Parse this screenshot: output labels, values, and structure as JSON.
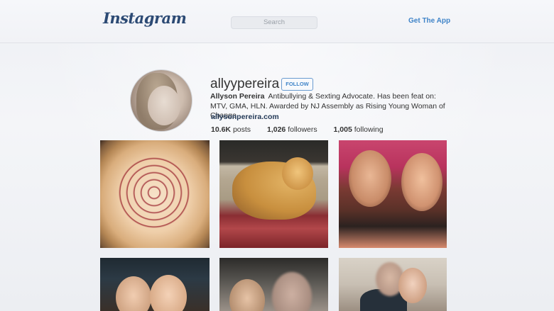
{
  "header": {
    "logo": "Instagram",
    "search_placeholder": "Search",
    "get_app_label": "Get The App"
  },
  "profile": {
    "username": "allyypereira",
    "follow_label": "FOLLOW",
    "full_name": "Allyson Pereira",
    "bio": "Antibullying & Sexting Advocate. Has been feat on: MTV, GMA, HLN. Awarded by NJ Assembly as Rising Young Woman of Change",
    "website": "allysonpereira.com",
    "stats": {
      "posts_count": "10.6K",
      "posts_label": "posts",
      "followers_count": "1,026",
      "followers_label": "followers",
      "following_count": "1,005",
      "following_label": "following"
    }
  },
  "colors": {
    "link_blue": "#3f84c8",
    "logo_navy": "#2c4a74"
  }
}
